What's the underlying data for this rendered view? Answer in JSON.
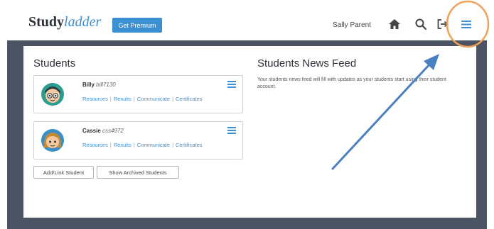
{
  "header": {
    "logo_part1": "Study",
    "logo_part2": "ladder",
    "premium_label": "Get Premium",
    "user_name": "Sally Parent",
    "icons": [
      "home-icon",
      "search-icon",
      "logout-icon",
      "menu-icon"
    ]
  },
  "students": {
    "heading": "Students",
    "items": [
      {
        "name": "Billy",
        "username": "bill7130",
        "links": [
          "Resources",
          "Results",
          "Communicate",
          "Certificates"
        ]
      },
      {
        "name": "Cassie",
        "username": "css4972",
        "links": [
          "Resources",
          "Results",
          "Communicate",
          "Certificates"
        ]
      }
    ],
    "add_button": "Add/Link Student",
    "archived_button": "Show Archived Students"
  },
  "news_feed": {
    "heading": "Students News Feed",
    "text": "Your students news feed will fill with updates as your students start using their student account."
  },
  "colors": {
    "accent": "#3c8fd2",
    "frame": "#4b5463",
    "annotation_circle": "#f0a25a",
    "annotation_arrow": "#4a7fc2"
  }
}
